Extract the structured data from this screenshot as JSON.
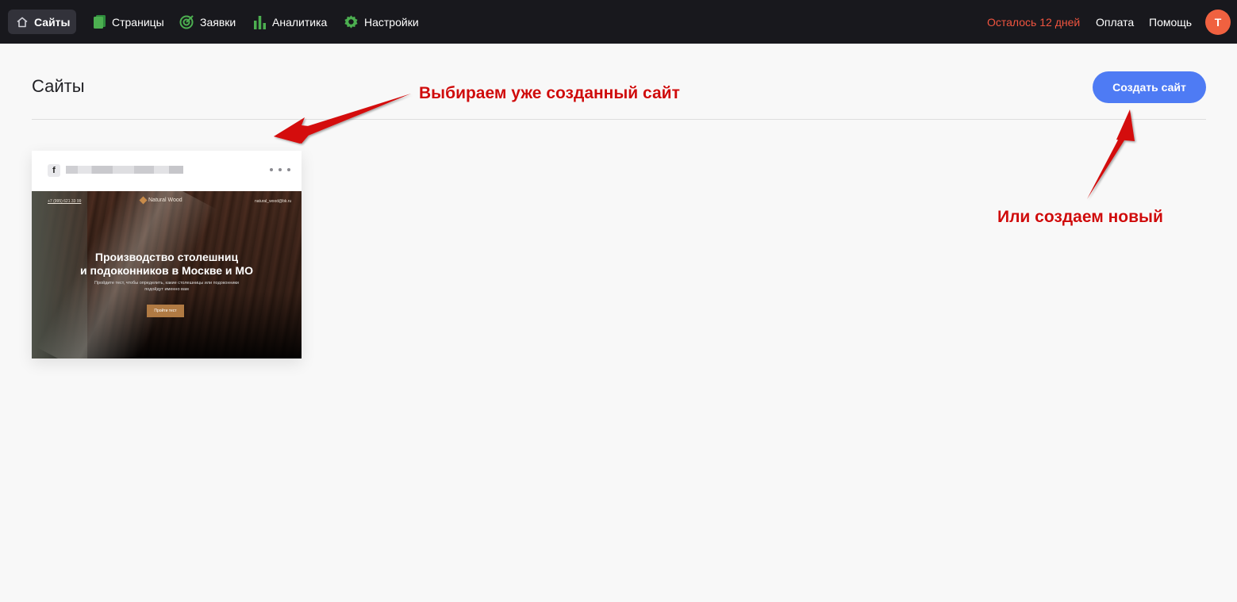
{
  "nav": {
    "items": [
      {
        "label": "Сайты",
        "icon": "home-icon",
        "active": true
      },
      {
        "label": "Страницы",
        "icon": "pages-icon"
      },
      {
        "label": "Заявки",
        "icon": "target-icon"
      },
      {
        "label": "Аналитика",
        "icon": "bar-chart-icon"
      },
      {
        "label": "Настройки",
        "icon": "gear-icon"
      }
    ],
    "trial_text": "Осталось 12 дней",
    "payment": "Оплата",
    "help": "Помощь",
    "avatar_letter": "T"
  },
  "header": {
    "title": "Сайты",
    "create_button": "Создать сайт"
  },
  "site_card": {
    "icon": "facebook-icon",
    "preview": {
      "phone": "+7 (995) 621 33 99",
      "logo": "Natural Wood",
      "email": "natural_wood@bk.ru",
      "title_line1": "Производство столешниц",
      "title_line2": "и подоконников в Москве и МО",
      "subtitle": "Пройдите тест, чтобы определить, какие столешницы или подоконники подойдут именно вам",
      "button": "Пройти тест"
    }
  },
  "annotations": {
    "select_existing": "Выбираем уже созданный сайт",
    "or_create_new": "Или создаем новый"
  },
  "colors": {
    "topbar": "#18181d",
    "accent_blue": "#4e7bf4",
    "trial_red": "#f0543f",
    "icon_green": "#4caf50",
    "annotation_red": "#cf0c0c",
    "avatar": "#f06140"
  }
}
